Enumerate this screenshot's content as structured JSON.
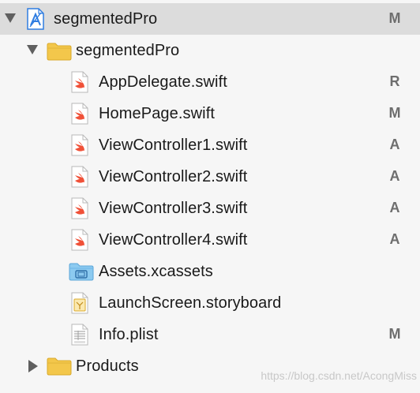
{
  "navigator": {
    "rows": [
      {
        "label": "segmentedPro",
        "status": "M",
        "icon": "xcode-project-icon",
        "disclosure": "expanded"
      },
      {
        "label": "segmentedPro",
        "status": "",
        "icon": "folder-icon",
        "disclosure": "expanded"
      },
      {
        "label": "AppDelegate.swift",
        "status": "R",
        "icon": "swift-file-icon"
      },
      {
        "label": "HomePage.swift",
        "status": "M",
        "icon": "swift-file-icon"
      },
      {
        "label": "ViewController1.swift",
        "status": "A",
        "icon": "swift-file-icon"
      },
      {
        "label": "ViewController2.swift",
        "status": "A",
        "icon": "swift-file-icon"
      },
      {
        "label": "ViewController3.swift",
        "status": "A",
        "icon": "swift-file-icon"
      },
      {
        "label": "ViewController4.swift",
        "status": "A",
        "icon": "swift-file-icon"
      },
      {
        "label": "Assets.xcassets",
        "status": "",
        "icon": "asset-catalog-folder-icon"
      },
      {
        "label": "LaunchScreen.storyboard",
        "status": "",
        "icon": "storyboard-file-icon"
      },
      {
        "label": "Info.plist",
        "status": "M",
        "icon": "plist-file-icon"
      },
      {
        "label": "Products",
        "status": "",
        "icon": "folder-icon",
        "disclosure": "collapsed"
      }
    ]
  },
  "watermark": "https://blog.csdn.net/AcongMiss",
  "colors": {
    "selection": "#dcdcdc",
    "background": "#f6f6f6",
    "swift_orange": "#f05138",
    "folder_yellow": "#f3c74b",
    "asset_blue": "#6cb6e8",
    "status_gray": "#6e6e6e"
  }
}
